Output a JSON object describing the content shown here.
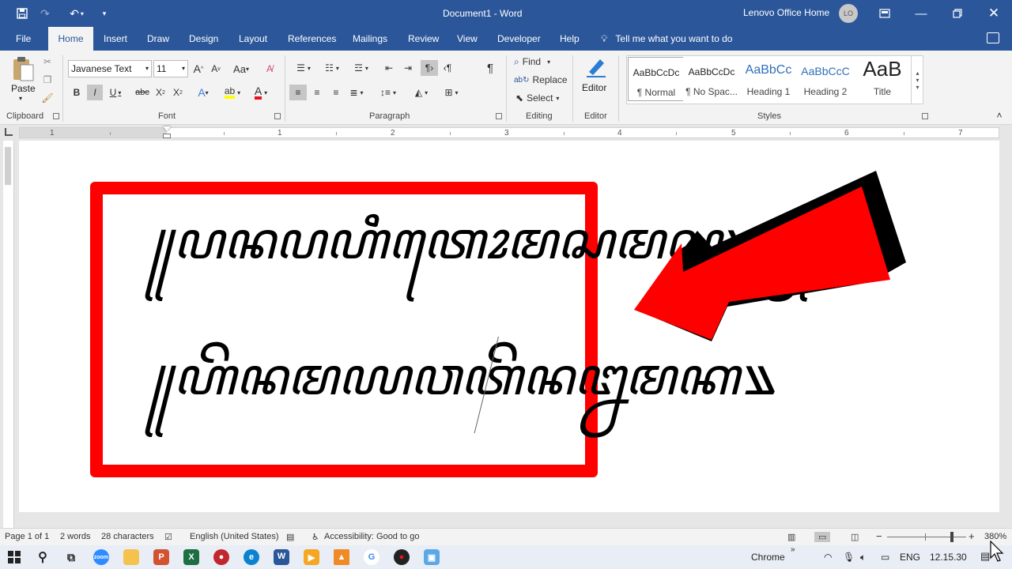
{
  "title_bar": {
    "document_title": "Document1  -  Word",
    "account_name": "Lenovo Office Home",
    "avatar_initials": "LO",
    "quick_access": [
      "save-icon",
      "redo-icon",
      "undo-icon",
      "customize-icon"
    ]
  },
  "tabs": [
    "File",
    "Home",
    "Insert",
    "Draw",
    "Design",
    "Layout",
    "References",
    "Mailings",
    "Review",
    "View",
    "Developer",
    "Help"
  ],
  "active_tab": "Home",
  "tell_me": "Tell me what you want to do",
  "ribbon": {
    "clipboard": {
      "paste_label": "Paste",
      "group_label": "Clipboard"
    },
    "font": {
      "font_name": "Javanese Text",
      "font_size": "11",
      "group_label": "Font"
    },
    "paragraph": {
      "group_label": "Paragraph"
    },
    "editing": {
      "find": "Find",
      "replace": "Replace",
      "select": "Select",
      "group_label": "Editing"
    },
    "editor": {
      "label": "Editor",
      "group_label": "Editor"
    },
    "styles": {
      "group_label": "Styles",
      "items": [
        {
          "preview": "AaBbCcDc",
          "name": "¶ Normal"
        },
        {
          "preview": "AaBbCcDc",
          "name": "¶ No Spac..."
        },
        {
          "preview": "AaBbCc",
          "name": "Heading 1"
        },
        {
          "preview": "AaBbCcC",
          "name": "Heading 2"
        },
        {
          "preview": "AaB",
          "name": "Title"
        }
      ]
    }
  },
  "ruler": {
    "numbers": [
      "1",
      "1",
      "2",
      "3",
      "4",
      "5",
      "6",
      "7"
    ]
  },
  "document": {
    "line1": "꧋ꦥꦤꦥꦲꦶꦠꦺꦴꦩꦱꦩꦱ꧈ꦥ꧀",
    "line2": "꧋ꦲꦼꦤꦩꦪꦮꦠꦼꦤꦊꦩꦏ꧉"
  },
  "status_bar": {
    "page": "Page 1 of 1",
    "words": "2 words",
    "characters": "28 characters",
    "language": "English (United States)",
    "accessibility": "Accessibility: Good to go",
    "zoom": "380%"
  },
  "taskbar": {
    "chrome_label": "Chrome",
    "language": "ENG",
    "time": "12.15.30"
  },
  "colors": {
    "word_blue": "#2b579a",
    "frame_red": "#ff0000",
    "arrow_red": "#ff0000"
  }
}
